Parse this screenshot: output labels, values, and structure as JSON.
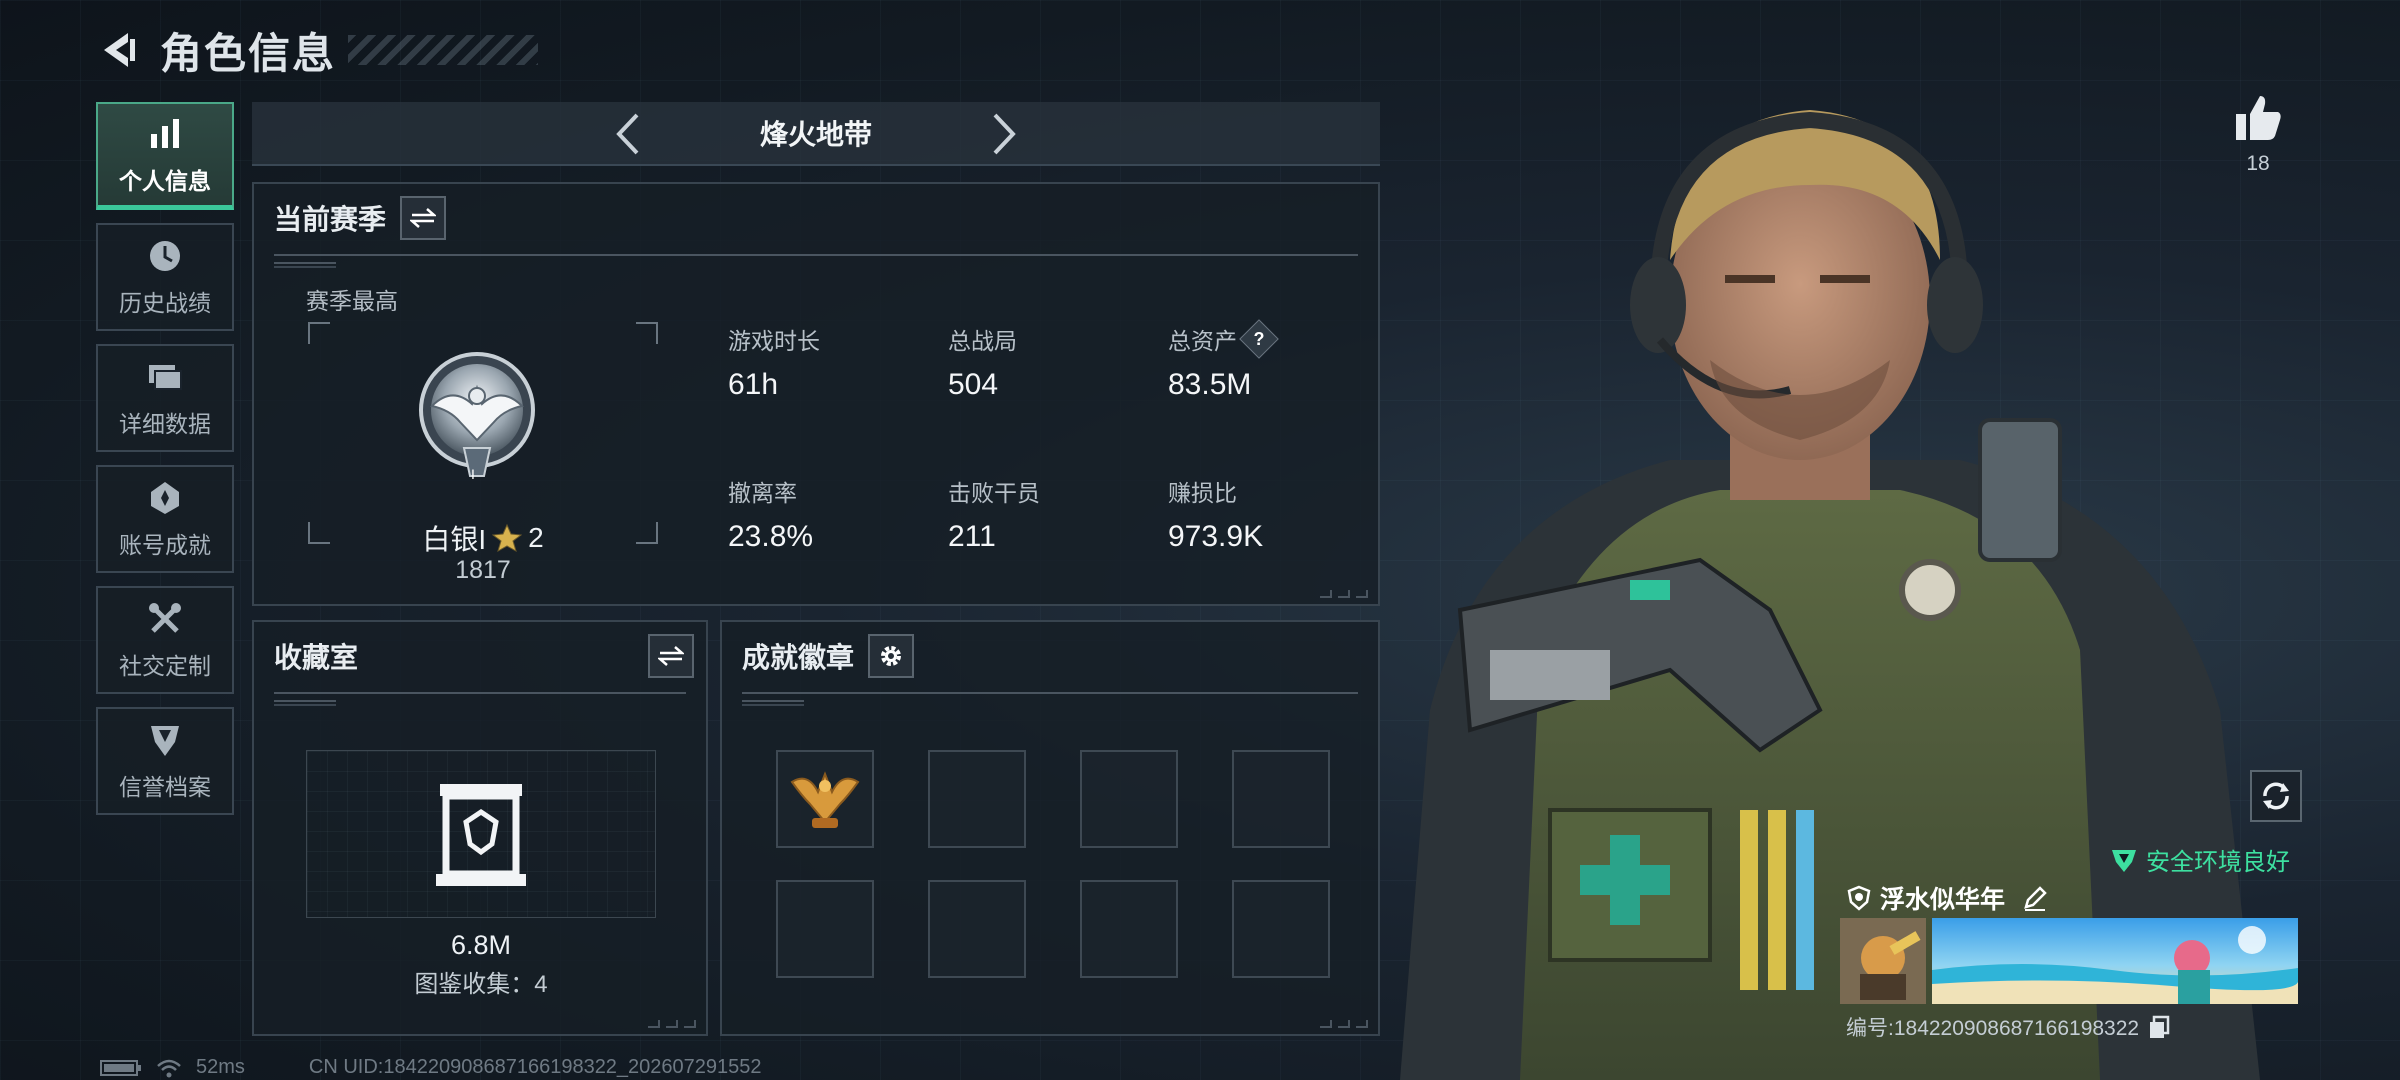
{
  "header": {
    "title": "角色信息"
  },
  "nav": {
    "items": [
      {
        "label": "个人信息"
      },
      {
        "label": "历史战绩"
      },
      {
        "label": "详细数据"
      },
      {
        "label": "账号成就"
      },
      {
        "label": "社交定制"
      },
      {
        "label": "信誉档案"
      }
    ]
  },
  "mode": {
    "title": "烽火地带"
  },
  "season": {
    "title": "当前赛季",
    "best_label": "赛季最高",
    "rank_name": "白银I",
    "rank_stars": "2",
    "rank_score": "1817",
    "rank_numeral": "I",
    "stats": [
      {
        "label": "游戏时长",
        "value": "61h"
      },
      {
        "label": "总战局",
        "value": "504"
      },
      {
        "label": "总资产",
        "value": "83.5M"
      },
      {
        "label": "撤离率",
        "value": "23.8%"
      },
      {
        "label": "击败干员",
        "value": "211"
      },
      {
        "label": "赚损比",
        "value": "973.9K"
      }
    ],
    "help_mark": "?"
  },
  "collection": {
    "title": "收藏室",
    "value": "6.8M",
    "count_text": "图鉴收集：4"
  },
  "badges": {
    "title": "成就徽章"
  },
  "player": {
    "likes": "18",
    "safe_text": "安全环境良好",
    "name": "浮水似华年",
    "id_text": "编号:18422090868716619832​2"
  },
  "footer": {
    "ping": "52ms",
    "uid_text": "CN UID:18422090868716619832​2_202607291552"
  },
  "colors": {
    "accent": "#3bc79a",
    "safe": "#3de0a0",
    "panel_border": "#38444f"
  }
}
